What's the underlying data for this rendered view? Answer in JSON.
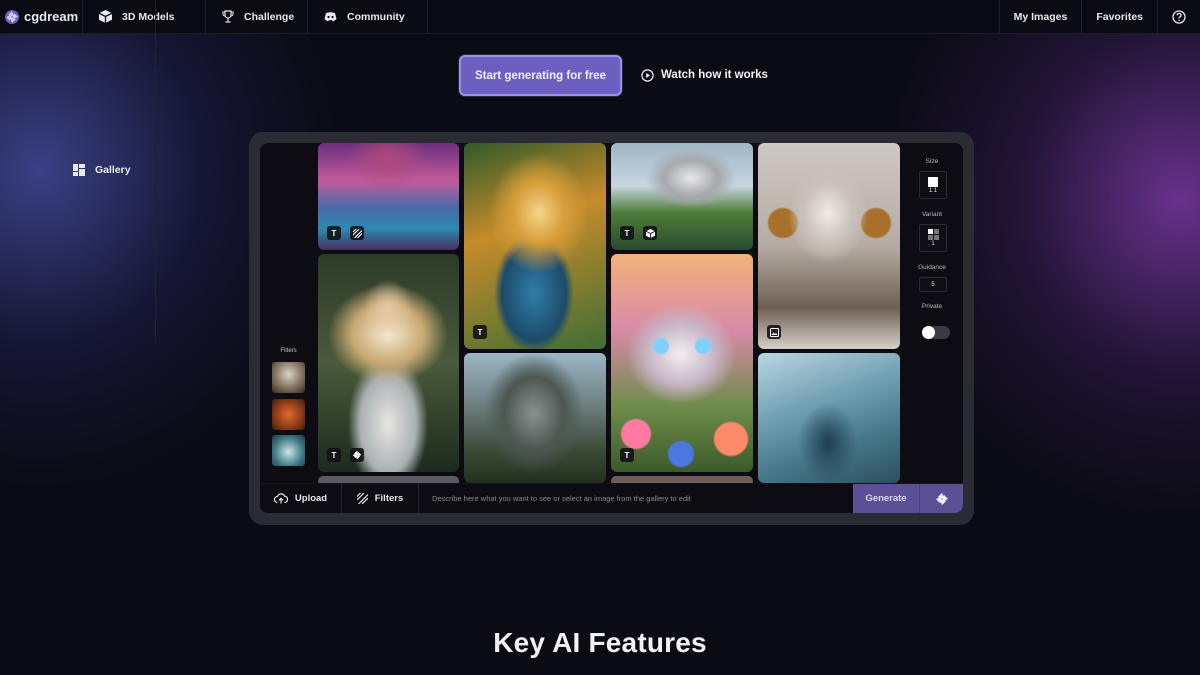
{
  "nav": {
    "logo_text": "cgdream",
    "items": [
      {
        "label": "Gallery",
        "icon": "grid-icon"
      },
      {
        "label": "3D Models",
        "icon": "cube-icon"
      },
      {
        "label": "Challenge",
        "icon": "trophy-icon"
      },
      {
        "label": "Community",
        "icon": "discord-icon"
      }
    ],
    "right": {
      "my_images": "My Images",
      "favorites": "Favorites",
      "help_icon": "question-circle-icon"
    }
  },
  "hero": {
    "cta_label": "Start generating for free",
    "watch_label": "Watch how it works",
    "watch_icon": "play-circle-icon"
  },
  "app": {
    "filters_title": "Filters",
    "gallery_tiles": [
      {
        "subject": "fantasy alien landscape",
        "badges": [
          "T",
          "filter-icon"
        ]
      },
      {
        "subject": "golden-haired princess",
        "badges": [
          "T"
        ]
      },
      {
        "subject": "futuristic dome house",
        "badges": [
          "T",
          "cube-icon"
        ]
      },
      {
        "subject": "robot woman with headphones",
        "badges": [
          "image-icon"
        ]
      },
      {
        "subject": "winged fairy",
        "badges": [
          "T",
          "cgdream-logo-icon"
        ]
      },
      {
        "subject": "stone castle",
        "badges": []
      },
      {
        "subject": "flower kitten",
        "badges": [
          "T"
        ]
      },
      {
        "subject": "organic blue architecture",
        "badges": []
      }
    ],
    "settings": {
      "size_label": "Size",
      "size_value": "1:1",
      "variant_label": "Variant",
      "variant_value": "1",
      "guidance_label": "Guidance",
      "guidance_value": "5",
      "private_label": "Private",
      "private_on": false
    },
    "bottom_bar": {
      "upload_label": "Upload",
      "filters_label": "Filters",
      "prompt_placeholder": "Describe here what you want to see or select an image from the gallery to edit",
      "prompt_value": "",
      "generate_label": "Generate"
    }
  },
  "section": {
    "title": "Key AI Features"
  },
  "colors": {
    "accent": "#6c5fc0",
    "accent_border": "#9d92e0",
    "generate_bg": "#5b4f96",
    "page_bg": "#0b0b14"
  }
}
